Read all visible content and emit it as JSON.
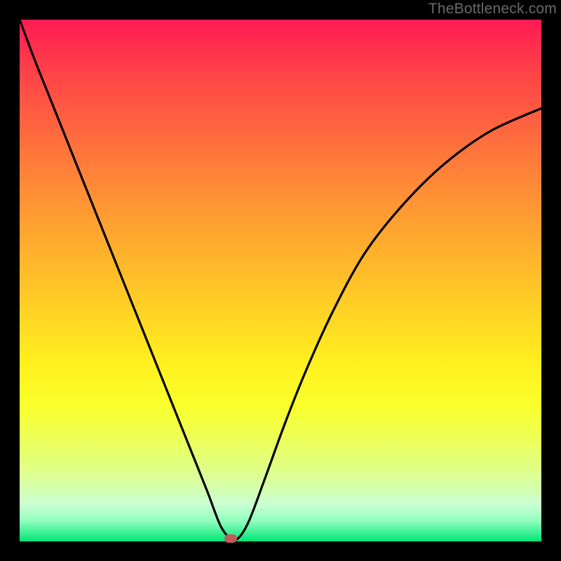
{
  "watermark": {
    "text": "TheBottleneck.com"
  },
  "colors": {
    "frame": "#000000",
    "curve_stroke": "#000000",
    "marker_fill": "#c65a5a",
    "gradient_top": "#ff1a54",
    "gradient_bottom": "#00e676"
  },
  "chart_data": {
    "type": "line",
    "title": "",
    "xlabel": "",
    "ylabel": "",
    "xlim": [
      0,
      100
    ],
    "ylim": [
      0,
      100
    ],
    "grid": false,
    "legend": false,
    "series": [
      {
        "name": "bottleneck-curve",
        "x": [
          0,
          3,
          6,
          9,
          12,
          15,
          18,
          21,
          24,
          27,
          30,
          33,
          36,
          38.5,
          40.5,
          42,
          44,
          47,
          51,
          55,
          60,
          66,
          73,
          81,
          90,
          100
        ],
        "y": [
          100,
          92,
          84.5,
          77,
          69.5,
          62,
          54.5,
          47,
          39.5,
          32,
          24.5,
          17,
          9.5,
          3,
          0.5,
          0.7,
          4,
          12,
          23,
          33,
          44,
          55,
          64,
          72,
          78.5,
          83
        ]
      }
    ],
    "marker": {
      "x": 40.5,
      "y": 0.5
    },
    "background_gradient": {
      "type": "vertical",
      "stops": [
        {
          "pos": 0.0,
          "color": "#ff1a54"
        },
        {
          "pos": 0.1,
          "color": "#ff4247"
        },
        {
          "pos": 0.22,
          "color": "#ff6a3e"
        },
        {
          "pos": 0.33,
          "color": "#ff8e35"
        },
        {
          "pos": 0.45,
          "color": "#ffb22c"
        },
        {
          "pos": 0.56,
          "color": "#ffd324"
        },
        {
          "pos": 0.66,
          "color": "#fff01e"
        },
        {
          "pos": 0.74,
          "color": "#f9ff2b"
        },
        {
          "pos": 0.8,
          "color": "#edff55"
        },
        {
          "pos": 0.86,
          "color": "#e0ff86"
        },
        {
          "pos": 0.9,
          "color": "#d4ffb0"
        },
        {
          "pos": 0.93,
          "color": "#c9ffd2"
        },
        {
          "pos": 0.96,
          "color": "#92ffbe"
        },
        {
          "pos": 1.0,
          "color": "#00e676"
        }
      ]
    }
  }
}
